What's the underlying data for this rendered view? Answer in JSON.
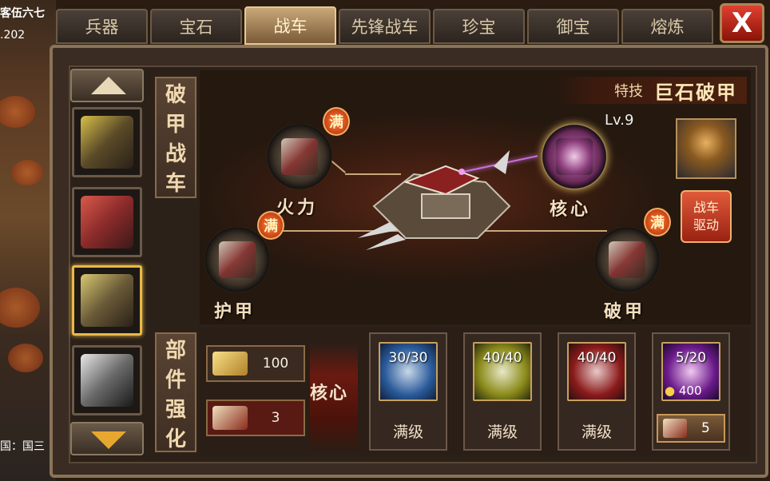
{
  "hud": {
    "player_name": "客伍六七",
    "value": ".202",
    "bottom_text": "国：国三"
  },
  "tabs": [
    "兵器",
    "宝石",
    "战车",
    "先锋战车",
    "珍宝",
    "御宝",
    "熔炼"
  ],
  "active_tab": 2,
  "close_label": "X",
  "vehicle_title": [
    "破",
    "甲",
    "战",
    "车"
  ],
  "skill": {
    "tag": "特技",
    "name": "巨石破甲"
  },
  "nodes": {
    "firepower": {
      "label": "火力",
      "badge": "满"
    },
    "armor": {
      "label": "护甲",
      "badge": "满"
    },
    "core": {
      "label": "核心",
      "level": "Lv.9"
    },
    "breach": {
      "label": "破甲",
      "badge": "满"
    }
  },
  "drive_button": {
    "line1": "战车",
    "line2": "驱动"
  },
  "enhance_title": [
    "部",
    "件",
    "强",
    "化"
  ],
  "resources": {
    "gold_bars": "100",
    "scrolls": "3"
  },
  "current_part": "核心",
  "components": [
    {
      "count": "30/30",
      "status": "满级",
      "color": "#2a5a9a"
    },
    {
      "count": "40/40",
      "status": "满级",
      "color": "#8a8a1a"
    },
    {
      "count": "40/40",
      "status": "满级",
      "color": "#8a1a1a"
    },
    {
      "count": "5/20",
      "gold": "400",
      "cost": "5",
      "color": "#6a1a8a"
    }
  ]
}
